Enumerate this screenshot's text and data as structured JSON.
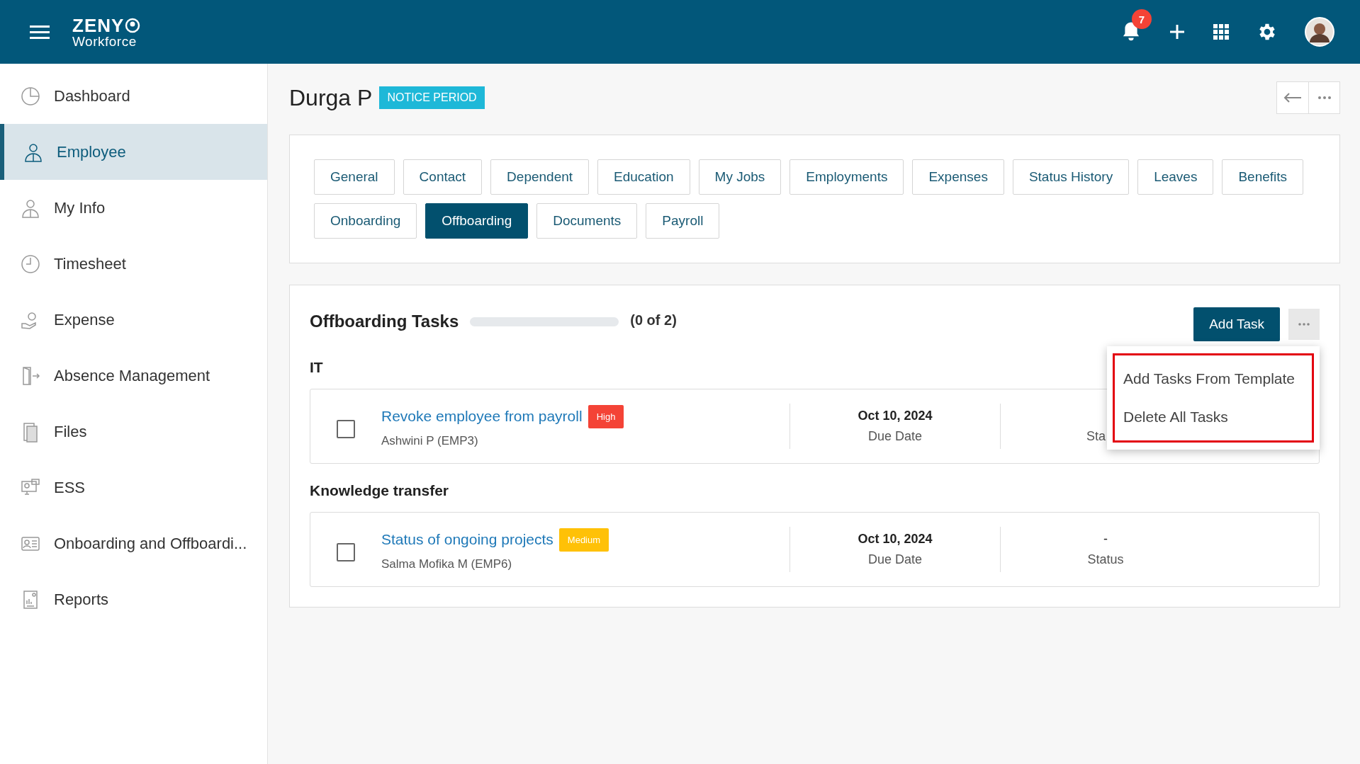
{
  "top_bar": {
    "logo_top": "ZENY",
    "logo_bottom": "Workforce",
    "notification_count": "7"
  },
  "sidebar": {
    "items": [
      {
        "label": "Dashboard",
        "selected": false
      },
      {
        "label": "Employee",
        "selected": true
      },
      {
        "label": "My Info",
        "selected": false
      },
      {
        "label": "Timesheet",
        "selected": false
      },
      {
        "label": "Expense",
        "selected": false
      },
      {
        "label": "Absence Management",
        "selected": false
      },
      {
        "label": "Files",
        "selected": false
      },
      {
        "label": "ESS",
        "selected": false
      },
      {
        "label": "Onboarding and Offboardi...",
        "selected": false
      },
      {
        "label": "Reports",
        "selected": false
      }
    ]
  },
  "header": {
    "name": "Durga P",
    "badge": "NOTICE PERIOD"
  },
  "tabs": [
    {
      "label": "General",
      "selected": false
    },
    {
      "label": "Contact",
      "selected": false
    },
    {
      "label": "Dependent",
      "selected": false
    },
    {
      "label": "Education",
      "selected": false
    },
    {
      "label": "My Jobs",
      "selected": false
    },
    {
      "label": "Employments",
      "selected": false
    },
    {
      "label": "Expenses",
      "selected": false
    },
    {
      "label": "Status History",
      "selected": false
    },
    {
      "label": "Leaves",
      "selected": false
    },
    {
      "label": "Benefits",
      "selected": false
    },
    {
      "label": "Onboarding",
      "selected": false
    },
    {
      "label": "Offboarding",
      "selected": true
    },
    {
      "label": "Documents",
      "selected": false
    },
    {
      "label": "Payroll",
      "selected": false
    }
  ],
  "tasks_panel": {
    "title": "Offboarding Tasks",
    "count": "(0 of 2)",
    "add_button": "Add Task",
    "menu": {
      "highlighted": true,
      "items": [
        "Add Tasks From Template",
        "Delete All Tasks"
      ]
    },
    "groups": [
      {
        "name": "IT",
        "tasks": [
          {
            "title": "Revoke employee from payroll",
            "priority": "High",
            "color": "#f44336",
            "assignee": "Ashwini P (EMP3)",
            "date": "Oct 10, 2024",
            "date_label": "Due Date",
            "status_label": "Sta",
            "checked": false
          }
        ]
      },
      {
        "name": "Knowledge transfer",
        "tasks": [
          {
            "title": "Status of ongoing projects",
            "priority": "Medium",
            "color": "#ffc107",
            "assignee": "Salma Mofika M (EMP6)",
            "date": "Oct 10, 2024",
            "date_label": "Due Date",
            "status": "-",
            "status_label": "Status",
            "checked": false
          }
        ]
      }
    ]
  }
}
